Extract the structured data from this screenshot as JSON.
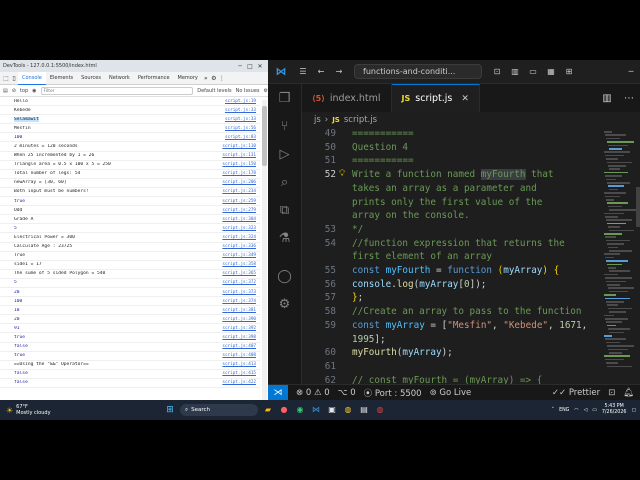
{
  "devtools": {
    "window_title": "DevTools - 127.0.0.1:5500/index.html",
    "tabs": [
      "Console",
      "Elements",
      "Sources",
      "Network",
      "Performance",
      "Memory"
    ],
    "toolbar": {
      "context": "top",
      "filter_placeholder": "Filter",
      "levels": "Default levels",
      "issues": "No Issues"
    },
    "console_rows": [
      {
        "msg": "Hello",
        "src": "script.js:19",
        "kind": "text"
      },
      {
        "msg": "Kebede",
        "src": "script.js:33",
        "kind": "text"
      },
      {
        "msg": "Selamawit",
        "src": "script.js:33",
        "kind": "hl"
      },
      {
        "msg": "Mesfin",
        "src": "script.js:56",
        "kind": "text"
      },
      {
        "msg": "100",
        "src": "script.js:83",
        "kind": "num"
      },
      {
        "msg": "2 minutes = 120 seconds",
        "src": "script.js:110",
        "kind": "text"
      },
      {
        "msg": "When 25 incremented by 1 = 26",
        "src": "script.js:131",
        "kind": "text"
      },
      {
        "msg": "Triangle area =  0.5 x 100 x 5 = 250",
        "src": "script.js:150",
        "kind": "text"
      },
      {
        "msg": "Total number of legs: 54",
        "src": "script.js:178",
        "kind": "text"
      },
      {
        "msg": "newArray = [30, 60]",
        "src": "script.js:206",
        "kind": "text"
      },
      {
        "msg": "Both input must be numbers!",
        "src": "script.js:234",
        "kind": "text"
      },
      {
        "msg": "true",
        "src": "script.js:259",
        "kind": "bool"
      },
      {
        "msg": "Odd",
        "src": "script.js:279",
        "kind": "text"
      },
      {
        "msg": "Grade A",
        "src": "script.js:304",
        "kind": "text"
      },
      {
        "msg": "5",
        "src": "script.js:323",
        "kind": "num"
      },
      {
        "msg": "Electrical Power = 300",
        "src": "script.js:324",
        "kind": "text"
      },
      {
        "msg": "Calculate Age : 23725",
        "src": "script.js:336",
        "kind": "text"
      },
      {
        "msg": "True",
        "src": "script.js:349",
        "kind": "text"
      },
      {
        "msg": "side1 = 17",
        "src": "script.js:358",
        "kind": "text"
      },
      {
        "msg": "The sume of 5 sided Polygon = 540",
        "src": "script.js:365",
        "kind": "text"
      },
      {
        "msg": "5",
        "src": "script.js:372",
        "kind": "num"
      },
      {
        "msg": "20",
        "src": "script.js:373",
        "kind": "num"
      },
      {
        "msg": "100",
        "src": "script.js:374",
        "kind": "num"
      },
      {
        "msg": "10",
        "src": "script.js:381",
        "kind": "num"
      },
      {
        "msg": "20",
        "src": "script.js:390",
        "kind": "num"
      },
      {
        "msg": "91",
        "src": "script.js:392",
        "kind": "num"
      },
      {
        "msg": "true",
        "src": "script.js:398",
        "kind": "bool"
      },
      {
        "msg": "false",
        "src": "script.js:407",
        "kind": "bool"
      },
      {
        "msg": "true",
        "src": "script.js:408",
        "kind": "bool"
      },
      {
        "msg": "==Using the \"&&\" Operator==",
        "src": "script.js:413",
        "kind": "text"
      },
      {
        "msg": "false",
        "src": "script.js:415",
        "kind": "bool"
      },
      {
        "msg": "false",
        "src": "script.js:422",
        "kind": "bool"
      }
    ]
  },
  "vscode": {
    "command_center": "functions-and-conditi...",
    "tabs": [
      {
        "label": "index.html",
        "icon": "html-icon",
        "active": false
      },
      {
        "label": "script.js",
        "icon": "js-icon",
        "active": true
      }
    ],
    "breadcrumb": [
      "js",
      "script.js"
    ],
    "lines": [
      {
        "n": "49",
        "html": "<span class='c'>  ===========</span>"
      },
      {
        "n": "50",
        "html": "<span class='c'>  Question 4</span>"
      },
      {
        "n": "51",
        "html": "<span class='c'>  ===========</span>"
      },
      {
        "n": "52",
        "html": "<span class='c'>    Write a function named <span class='sel'>myFourth</span> that</span>",
        "cur": true,
        "bulb": true
      },
      {
        "n": "",
        "html": "<span class='c'>    takes an array as a parameter and</span>"
      },
      {
        "n": "",
        "html": "<span class='c'>    prints only the first value of the</span>"
      },
      {
        "n": "",
        "html": "<span class='c'>    array on the console.</span>"
      },
      {
        "n": "53",
        "html": "<span class='c'>*/</span>"
      },
      {
        "n": "54",
        "html": "<span class='c'>//function expression that returns the</span>"
      },
      {
        "n": "",
        "html": "<span class='c'>first element of an array</span>"
      },
      {
        "n": "55",
        "html": "<span class='k'>const</span> <span class='v'>myFourth</span> <span class='o'>=</span> <span class='k'>function</span> <span class='y'>(</span><span class='p'>myArray</span><span class='y'>)</span> <span class='y'>{</span>"
      },
      {
        "n": "56",
        "html": "  <span class='p'>console</span><span class='o'>.</span><span class='fn'>log</span><span class='o'>(</span><span class='p'>myArray</span><span class='o'>[</span><span class='n'>0</span><span class='o'>]);</span>"
      },
      {
        "n": "57",
        "html": "<span class='y'>}</span><span class='o'>;</span>"
      },
      {
        "n": "58",
        "html": "<span class='c'>//Create an array to pass to the function</span>"
      },
      {
        "n": "59",
        "html": "<span class='k'>const</span> <span class='v'>myArray</span> <span class='o'>=</span> <span class='o'>[</span><span class='s'>\"Mesfin\"</span><span class='o'>,</span> <span class='s'>\"Kebede\"</span><span class='o'>,</span> <span class='n'>1671</span><span class='o'>,</span>"
      },
      {
        "n": "",
        "html": "<span class='n'>1995</span><span class='o'>];</span>"
      },
      {
        "n": "60",
        "html": "<span class='fn'>myFourth</span><span class='o'>(</span><span class='p'>myArray</span><span class='o'>);</span>"
      },
      {
        "n": "61",
        "html": ""
      },
      {
        "n": "62",
        "html": "<span class='c'>// const myFourth = (myArray) => {</span>"
      }
    ],
    "status": {
      "errors": "0",
      "warnings": "0",
      "ports": "0",
      "port": "Port : 5500",
      "golive": "Go Live",
      "prettier": "Prettier"
    }
  },
  "taskbar": {
    "temp": "67°F",
    "weather": "Mostly cloudy",
    "search": "Search",
    "lang": "ENG",
    "time": "5:43 PM",
    "date": "7/26/2026"
  }
}
